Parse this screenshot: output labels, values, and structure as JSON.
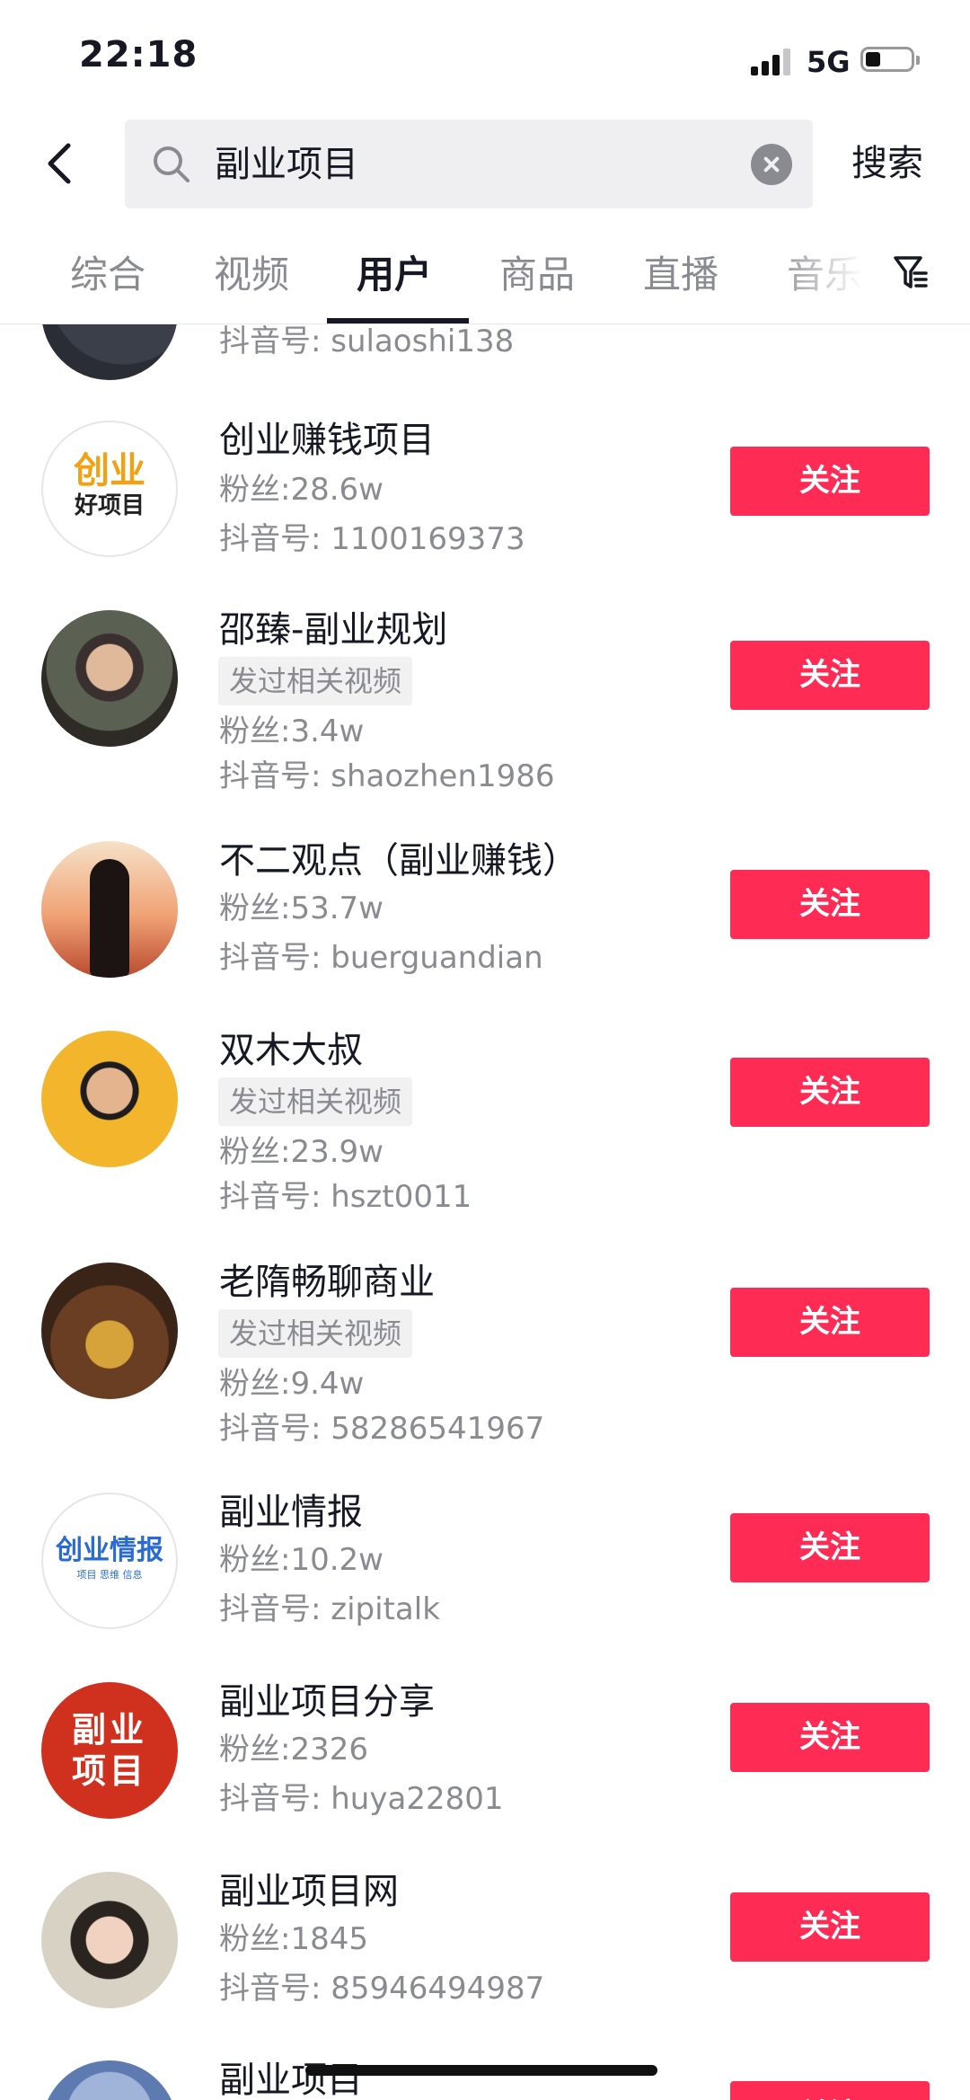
{
  "status_bar": {
    "time": "22:18",
    "network": "5G"
  },
  "search": {
    "query": "副业项目",
    "submit_label": "搜索"
  },
  "tabs": [
    {
      "label": "综合"
    },
    {
      "label": "视频"
    },
    {
      "label": "用户"
    },
    {
      "label": "商品"
    },
    {
      "label": "直播"
    },
    {
      "label": "音乐"
    }
  ],
  "active_tab": "用户",
  "colors": {
    "accent": "#fe2c55",
    "text_primary": "#161823",
    "text_secondary": "#8a8b91",
    "badge_bg": "#f1f1f2"
  },
  "follow_label": "关注",
  "users": [
    {
      "name": "",
      "fans": "",
      "douyin_id": "抖音号: sulaoshi138",
      "avatar_label": ""
    },
    {
      "name": "创业赚钱项目",
      "fans": "粉丝:28.6w",
      "douyin_id": "抖音号: 1100169373",
      "avatar_label": "创业",
      "avatar_label2": "好项目"
    },
    {
      "name": "邵臻-副业规划",
      "badge": "发过相关视频",
      "fans": "粉丝:3.4w",
      "douyin_id": "抖音号: shaozhen1986"
    },
    {
      "name": "不二观点（副业赚钱）",
      "fans": "粉丝:53.7w",
      "douyin_id": "抖音号: buerguandian"
    },
    {
      "name": "双木大叔",
      "badge": "发过相关视频",
      "fans": "粉丝:23.9w",
      "douyin_id": "抖音号: hszt0011"
    },
    {
      "name": "老隋畅聊商业",
      "badge": "发过相关视频",
      "fans": "粉丝:9.4w",
      "douyin_id": "抖音号: 58286541967"
    },
    {
      "name": "副业情报",
      "fans": "粉丝:10.2w",
      "douyin_id": "抖音号: zipitalk",
      "avatar_label": "创业情报",
      "avatar_label2": "项目 思维 信息"
    },
    {
      "name": "副业项目分享",
      "fans": "粉丝:2326",
      "douyin_id": "抖音号: huya22801",
      "avatar_label": "副业",
      "avatar_label2": "项目"
    },
    {
      "name": "副业项目网",
      "fans": "粉丝:1845",
      "douyin_id": "抖音号: 85946494987"
    },
    {
      "name": "副业项目"
    }
  ]
}
